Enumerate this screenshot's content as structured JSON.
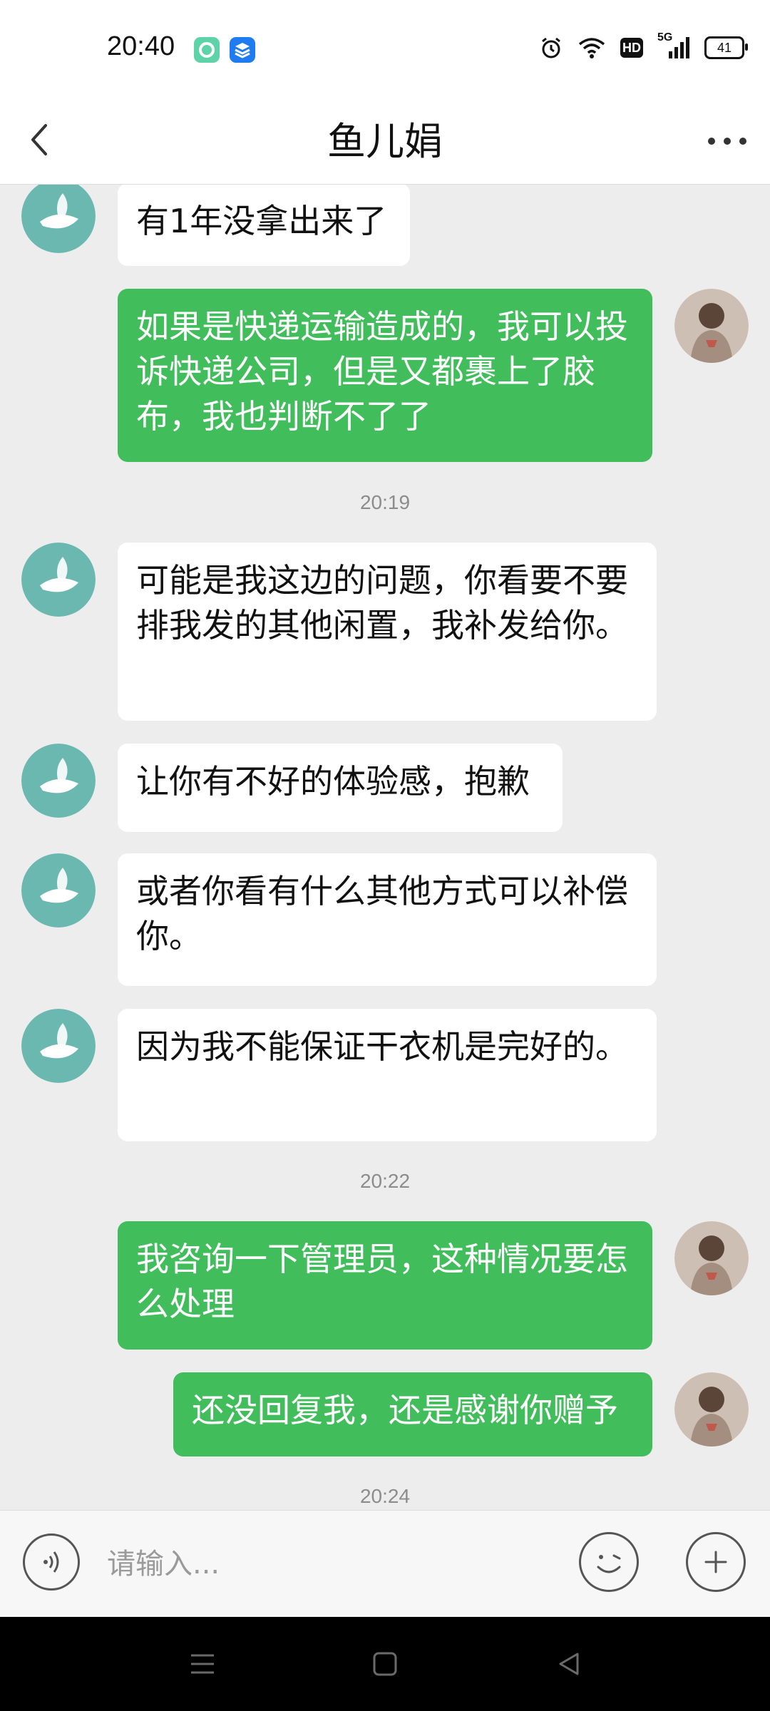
{
  "status_bar": {
    "time": "20:40",
    "app_icons": [
      "green-app-icon",
      "blue-app-icon"
    ],
    "icons": [
      "alarm-icon",
      "wifi-icon",
      "hd-icon",
      "5g-signal-icon",
      "battery-icon"
    ],
    "hd_label": "HD",
    "network_label": "5G",
    "battery_level": "41"
  },
  "nav": {
    "title": "鱼儿娟",
    "back_icon": "chevron-left-icon",
    "more_icon": "more-horizontal-icon"
  },
  "messages": [
    {
      "from": "other",
      "text": "有1年没拿出来了"
    },
    {
      "from": "me",
      "text": "如果是快递运输造成的，我可以投诉快递公司，但是又都裹上了胶布，我也判断不了了"
    },
    {
      "type": "time",
      "text": "20:19"
    },
    {
      "from": "other",
      "text": "可能是我这边的问题，你看要不要排我发的其他闲置，我补发给你。"
    },
    {
      "from": "other",
      "text": "让你有不好的体验感，抱歉"
    },
    {
      "from": "other",
      "text": "或者你看有什么其他方式可以补偿你。"
    },
    {
      "from": "other",
      "text": "因为我不能保证干衣机是完好的。"
    },
    {
      "type": "time",
      "text": "20:22"
    },
    {
      "from": "me",
      "text": "我咨询一下管理员，这种情况要怎么处理"
    },
    {
      "from": "me",
      "text": "还没回复我，还是感谢你赠予"
    },
    {
      "type": "time",
      "text": "20:24"
    }
  ],
  "input": {
    "placeholder": "请输入...",
    "voice_icon": "voice-icon",
    "emoji_icon": "emoji-icon",
    "plus_icon": "plus-icon"
  },
  "colors": {
    "outgoing_bubble": "#41bd5c",
    "incoming_bubble": "#ffffff",
    "chat_background": "#ededed",
    "avatar_other": "#6bb8b0"
  },
  "system_nav": {
    "icons": [
      "menu-icon",
      "home-icon",
      "back-triangle-icon"
    ]
  }
}
